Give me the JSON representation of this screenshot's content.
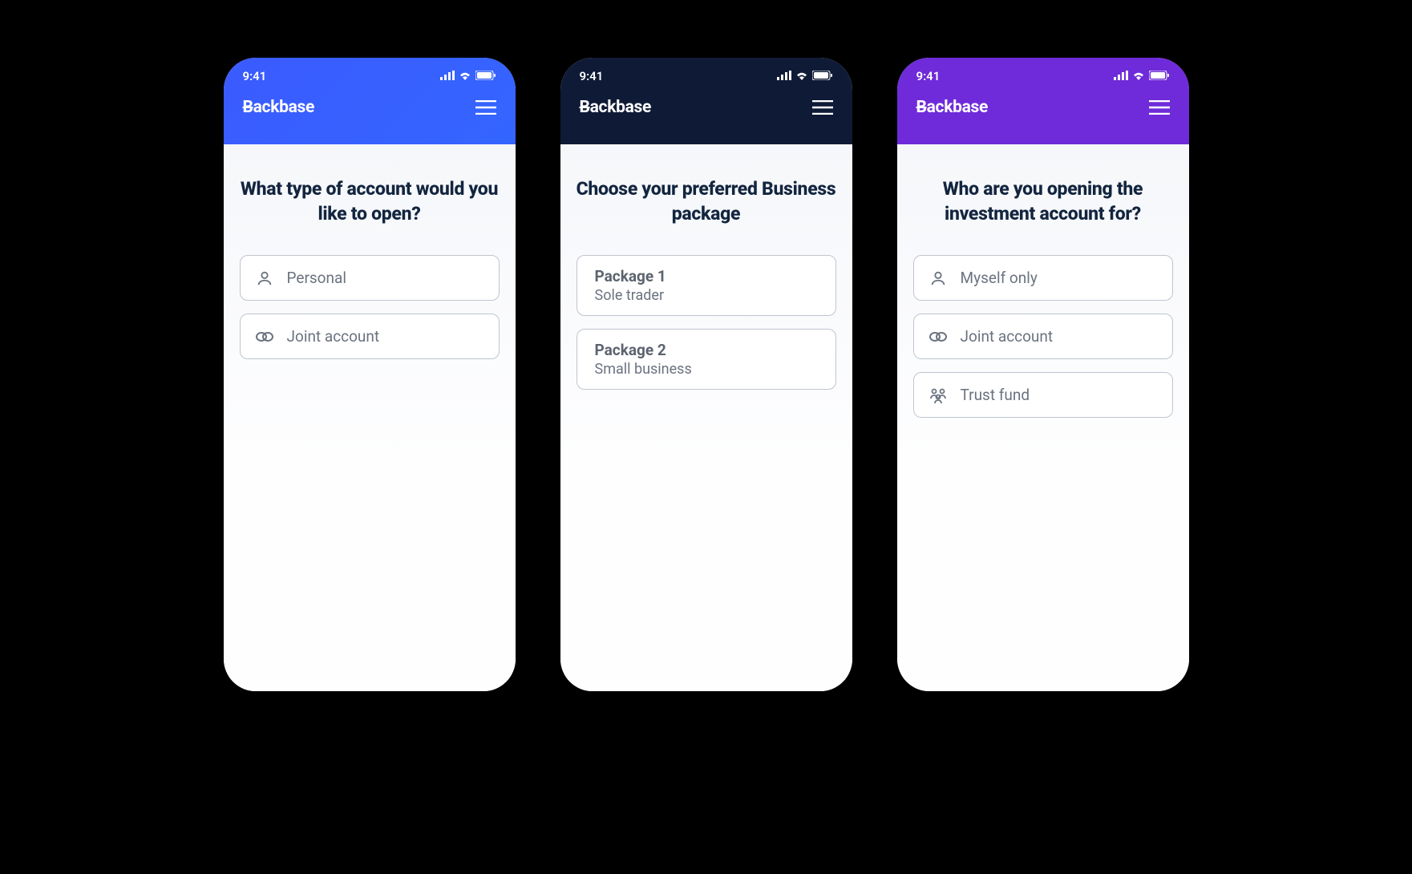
{
  "brand": "Backbase",
  "status_time": "9:41",
  "screens": [
    {
      "theme": "blue",
      "heading": "What type of account would you like to open?",
      "options": [
        {
          "icon": "user-icon",
          "label": "Personal"
        },
        {
          "icon": "link-icon",
          "label": "Joint account"
        }
      ]
    },
    {
      "theme": "navy",
      "heading": "Choose your preferred Business package",
      "options": [
        {
          "title": "Package 1",
          "subtitle": "Sole trader"
        },
        {
          "title": "Package 2",
          "subtitle": "Small business"
        }
      ]
    },
    {
      "theme": "purple",
      "heading": "Who are you opening the investment account for?",
      "options": [
        {
          "icon": "user-icon",
          "label": "Myself only"
        },
        {
          "icon": "link-icon",
          "label": "Joint account"
        },
        {
          "icon": "group-icon",
          "label": "Trust fund"
        }
      ]
    }
  ]
}
